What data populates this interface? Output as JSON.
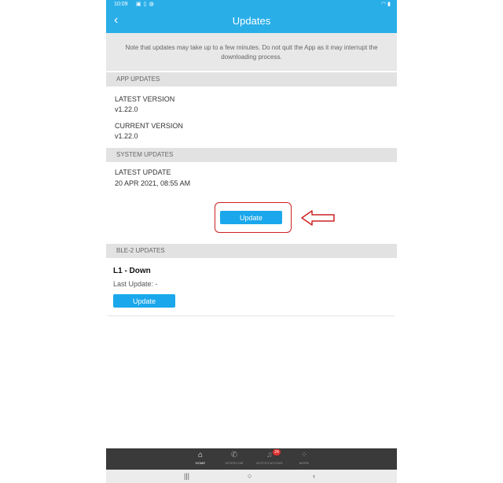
{
  "status_bar": {
    "time": "10:09",
    "icons": [
      "image-icon",
      "phone-icon",
      "android-icon"
    ],
    "right_icons": [
      "wifi-icon",
      "battery-icon"
    ]
  },
  "app_bar": {
    "title": "Updates"
  },
  "notice": "Note that updates may take up to a few minutes. Do not quit the App as it may interrupt the downloading process.",
  "app_updates": {
    "header": "APP UPDATES",
    "latest_label": "LATEST VERSION",
    "latest_value": "v1.22.0",
    "current_label": "CURRENT VERSION",
    "current_value": "v1.22.0"
  },
  "system_updates": {
    "header": "SYSTEM UPDATES",
    "latest_label": "LATEST UPDATE",
    "latest_value": "20 APR 2021, 08:55 AM",
    "button": "Update"
  },
  "ble_updates": {
    "header": "BLE-2 UPDATES",
    "device_name": "L1 - Down",
    "last_update": "Last Update: -",
    "button": "Update"
  },
  "bottom_nav": [
    {
      "label": "HOME",
      "icon": "home-icon",
      "active": true
    },
    {
      "label": "INTERCOM",
      "icon": "phone-icon",
      "active": false
    },
    {
      "label": "NOTIFICATIONS",
      "icon": "bell-icon",
      "active": false,
      "badge": "24"
    },
    {
      "label": "MORE",
      "icon": "grid-icon",
      "active": false
    }
  ],
  "annotation": {
    "color": "#cc2222"
  },
  "colors": {
    "primary": "#2aaee8",
    "button": "#1aa7ec",
    "section_bg": "#e2e2e2"
  }
}
